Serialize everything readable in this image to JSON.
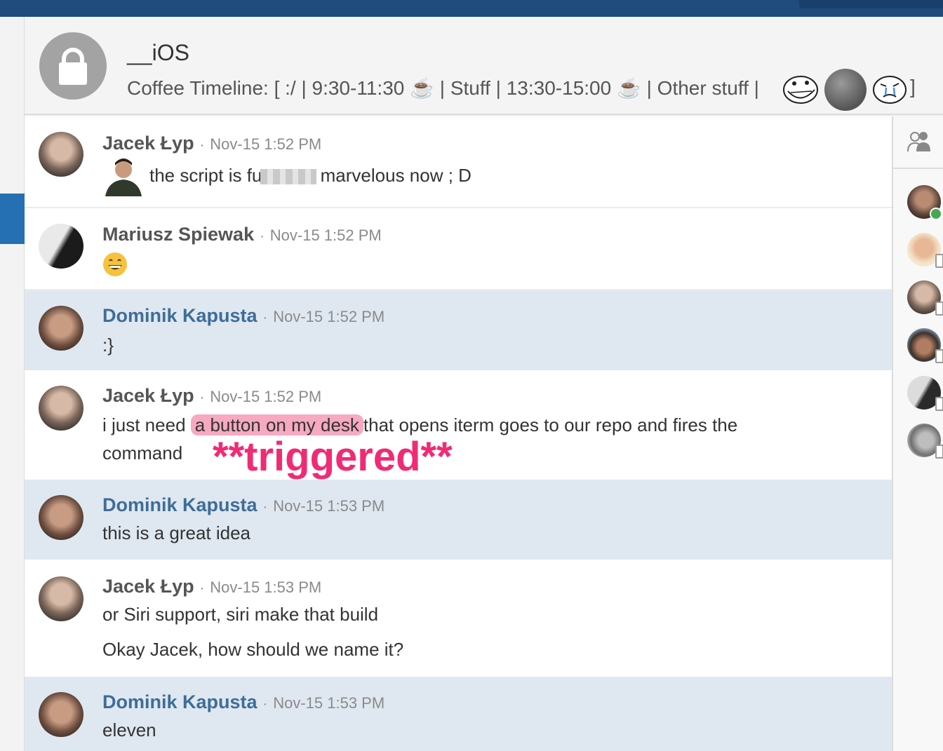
{
  "room": {
    "name": "__iOS",
    "topic": "Coffee Timeline: [ :/ | 9:30-11:30 ☕ | Stuff | 13:30-15:00 ☕ | Other stuff |",
    "topic_end": "]"
  },
  "messages": [
    {
      "author": "Jacek Łyp",
      "time": "Nov-15 1:52 PM",
      "text_before": "the script is fu",
      "text_after": "marvelous now ; D"
    },
    {
      "author": "Mariusz Spiewak",
      "time": "Nov-15 1:52 PM",
      "text": "😄"
    },
    {
      "author": "Dominik Kapusta",
      "time": "Nov-15 1:52 PM",
      "text": ":}"
    },
    {
      "author": "Jacek Łyp",
      "time": "Nov-15 1:52 PM",
      "text_before": "i just need",
      "highlight": "a button on my desk",
      "text_after": "that opens iterm goes to our repo and fires the",
      "line2": "command",
      "annotation": "**triggered**"
    },
    {
      "author": "Dominik Kapusta",
      "time": "Nov-15 1:53 PM",
      "text": "this is a great idea"
    },
    {
      "author": "Jacek Łyp",
      "time": "Nov-15 1:53 PM",
      "text": "or Siri support, siri make that build",
      "line2": "Okay Jacek, how should we name it?"
    },
    {
      "author": "Dominik Kapusta",
      "time": "Nov-15 1:53 PM",
      "text": "eleven"
    }
  ],
  "separator": "·",
  "icons": {
    "room": "lock-icon",
    "people": "people-icon",
    "topic_faces": [
      "troll-face-icon",
      "photo-avatar",
      "crying-face-icon"
    ]
  },
  "members": [
    {
      "status": "online"
    },
    {
      "status": "mobile"
    },
    {
      "status": "mobile"
    },
    {
      "status": "mobile"
    },
    {
      "status": "mobile"
    },
    {
      "status": "mobile"
    }
  ],
  "colors": {
    "topbar": "#1f4b7d",
    "accent": "#2470b3",
    "highlight_row": "#dfe8f0",
    "author_blue": "#3f6d9a",
    "annotation": "#f02b74",
    "mention_highlight": "#f6a9c0",
    "online": "#48a84f"
  }
}
